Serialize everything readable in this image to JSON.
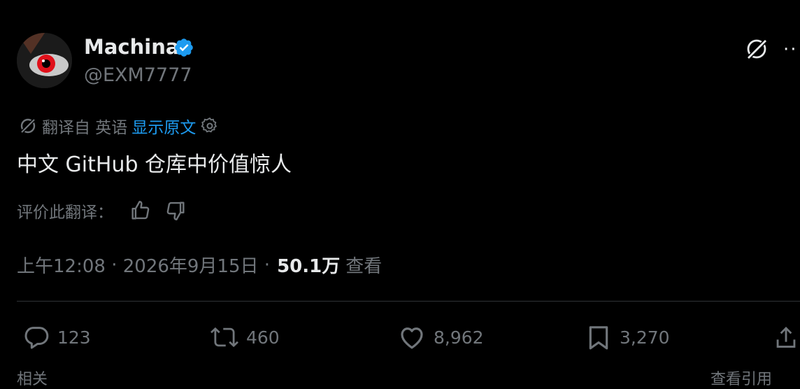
{
  "author": {
    "name": "Machina",
    "handle": "@EXM7777"
  },
  "translation": {
    "from_label": "翻译自 英语",
    "show_original": "显示原文"
  },
  "post": {
    "text": "中文 GitHub 仓库中价值惊人"
  },
  "rating": {
    "label": "评价此翻译："
  },
  "meta": {
    "time": "上午12:08",
    "date": "2026年9月15日",
    "views_count": "50.1万",
    "views_label": "查看"
  },
  "actions": {
    "replies": "123",
    "reposts": "460",
    "likes": "8,962",
    "bookmarks": "3,270"
  },
  "bottom": {
    "left_text": "相关",
    "right_text": "查看引用"
  },
  "colors": {
    "accent": "#1d9bf0",
    "muted": "#71767b",
    "text": "#e7e9ea",
    "background": "#000000"
  },
  "icons": [
    "verified-badge-icon",
    "grok-icon",
    "more-icon",
    "translate-icon",
    "settings-gear-icon",
    "thumbs-up-icon",
    "thumbs-down-icon",
    "reply-icon",
    "repost-icon",
    "like-icon",
    "bookmark-icon",
    "share-icon"
  ]
}
